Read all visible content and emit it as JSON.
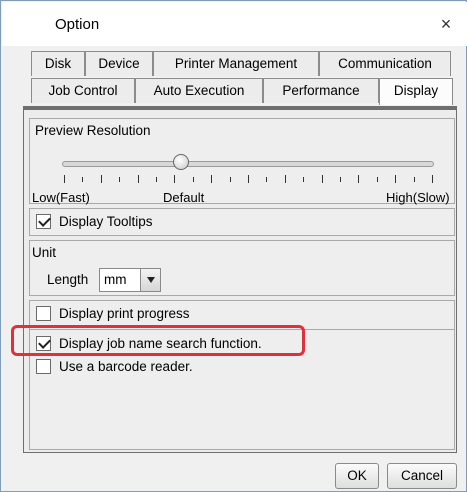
{
  "window": {
    "title": "Option",
    "close_glyph": "×"
  },
  "tabs": {
    "row1": [
      {
        "label": "Disk"
      },
      {
        "label": "Device"
      },
      {
        "label": "Printer Management"
      },
      {
        "label": "Communication"
      }
    ],
    "row2": [
      {
        "label": "Job Control"
      },
      {
        "label": "Auto Execution"
      },
      {
        "label": "Performance"
      },
      {
        "label": "Display",
        "active": true
      }
    ]
  },
  "preview_resolution": {
    "title": "Preview Resolution",
    "low_label": "Low(Fast)",
    "default_label": "Default",
    "high_label": "High(Slow)",
    "value_fraction": 0.32
  },
  "display_tooltips": {
    "label": "Display Tooltips",
    "checked": true
  },
  "unit": {
    "title": "Unit",
    "length_label": "Length",
    "length_value": "mm"
  },
  "options": [
    {
      "label": "Display print progress",
      "checked": false
    },
    {
      "label": "Display job name search function.",
      "checked": true
    },
    {
      "label": "Use a barcode reader.",
      "checked": false
    }
  ],
  "buttons": {
    "ok": "OK",
    "cancel": "Cancel"
  },
  "colors": {
    "highlight": "#e0303c",
    "accent_border": "#6f6f6f"
  }
}
